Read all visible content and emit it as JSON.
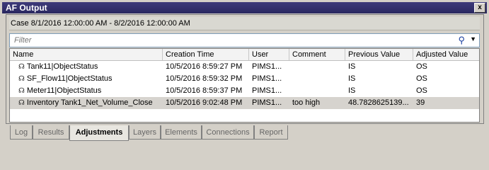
{
  "window": {
    "title": "AF Output",
    "close_glyph": "x"
  },
  "case": {
    "label": "Case 8/1/2016 12:00:00 AM  -  8/2/2016 12:00:00 AM"
  },
  "filter": {
    "placeholder": "Filter",
    "search_icon": "search-icon",
    "dropdown_icon": "chevron-down-icon"
  },
  "columns": [
    "Name",
    "Creation Time",
    "User",
    "Comment",
    "Previous Value",
    "Adjusted Value"
  ],
  "rows": [
    {
      "name": "Tank11|ObjectStatus",
      "time": "10/5/2016 8:59:27 PM",
      "user": "PIMS1...",
      "comment": "",
      "prev": "IS",
      "adj": "OS",
      "icon": "adjustment-icon"
    },
    {
      "name": "SF_Flow11|ObjectStatus",
      "time": "10/5/2016 8:59:32 PM",
      "user": "PIMS1...",
      "comment": "",
      "prev": "IS",
      "adj": "OS",
      "icon": "adjustment-icon"
    },
    {
      "name": "Meter11|ObjectStatus",
      "time": "10/5/2016 8:59:37 PM",
      "user": "PIMS1...",
      "comment": "",
      "prev": "IS",
      "adj": "OS",
      "icon": "adjustment-icon"
    },
    {
      "name": "Inventory Tank1_Net_Volume_Close",
      "time": "10/5/2016 9:02:48 PM",
      "user": "PIMS1...",
      "comment": "too high",
      "prev": "48.7828625139...",
      "adj": "39",
      "icon": "adjustment-icon",
      "selected": true
    }
  ],
  "tabs": [
    {
      "label": "Log"
    },
    {
      "label": "Results"
    },
    {
      "label": "Adjustments",
      "active": true
    },
    {
      "label": "Layers"
    },
    {
      "label": "Elements"
    },
    {
      "label": "Connections"
    },
    {
      "label": "Report"
    }
  ]
}
